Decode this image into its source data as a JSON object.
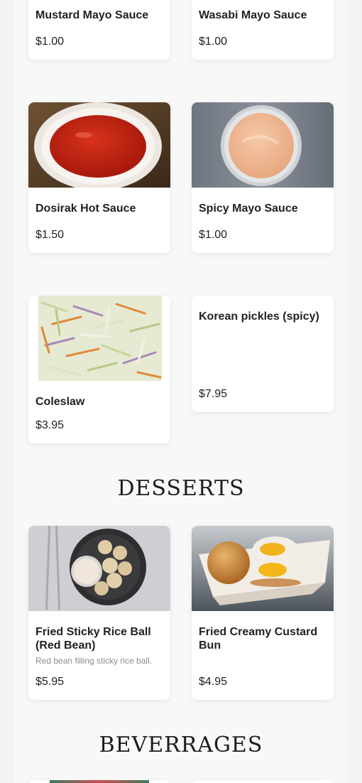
{
  "sections": {
    "desserts_title": "DESSERTS",
    "beverages_title": "BEVERRAGES"
  },
  "items": {
    "mustard_mayo": {
      "name": "Mustard Mayo Sauce",
      "price": "$1.00"
    },
    "wasabi_mayo": {
      "name": "Wasabi Mayo Sauce",
      "price": "$1.00"
    },
    "dosirak_hot": {
      "name": "Dosirak Hot Sauce",
      "price": "$1.50"
    },
    "spicy_mayo": {
      "name": "Spicy Mayo Sauce",
      "price": "$1.00"
    },
    "coleslaw": {
      "name": "Coleslaw",
      "price": "$3.95"
    },
    "korean_pickles": {
      "name": "Korean pickles (spicy)",
      "price": "$7.95"
    },
    "sticky_rice_ball": {
      "name": "Fried Sticky Rice Ball (Red Bean)",
      "description": "Red bean filling sticky rice ball.",
      "price": "$5.95"
    },
    "custard_bun": {
      "name": "Fried Creamy Custard Bun",
      "price": "$4.95"
    }
  },
  "colors": {
    "background": "#f3f3f3",
    "card": "#ffffff",
    "text": "#222222",
    "muted_text": "#8b8b8b"
  }
}
